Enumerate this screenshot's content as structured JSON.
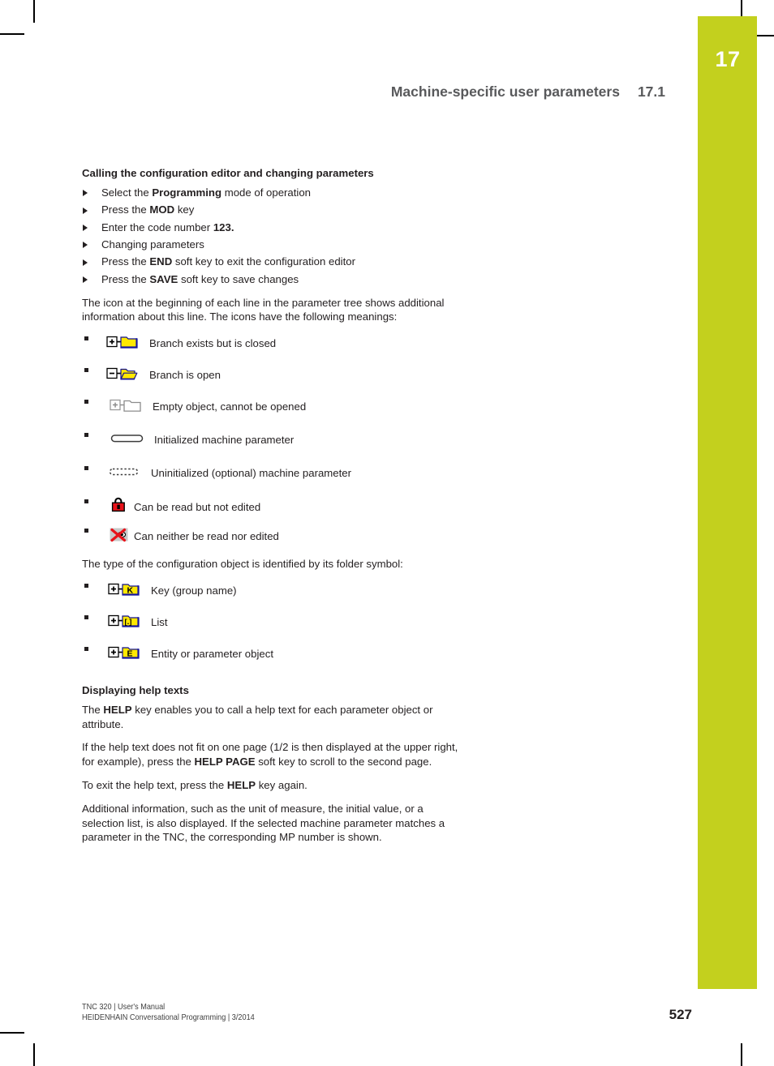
{
  "page": {
    "number": "527",
    "chapter_tab_number": "17",
    "accent_color": "#c3d01e",
    "running_head": {
      "title": "Machine-specific user parameters",
      "section": "17.1"
    }
  },
  "content": {
    "heading_1": "Calling the configuration editor and changing parameters",
    "steps": [
      {
        "prefix": "Select the ",
        "strong": "Programming",
        "suffix": " mode of operation"
      },
      {
        "prefix": "Press the ",
        "strong": "MOD",
        "suffix": " key"
      },
      {
        "prefix": "Enter the code number ",
        "strong": "123.",
        "suffix": ""
      },
      {
        "prefix": "Changing parameters",
        "strong": "",
        "suffix": ""
      },
      {
        "prefix": "Press the ",
        "strong": "END",
        "suffix": " soft key to exit the configuration editor"
      },
      {
        "prefix": "Press the ",
        "strong": "SAVE",
        "suffix": " soft key to save changes"
      }
    ],
    "paragraph_icons_intro": "The icon at the beginning of each line in the parameter tree shows additional information about this line. The icons have the following meanings:",
    "icon_items": [
      {
        "icon": "folder-closed-plus-icon",
        "label": "Branch exists but is closed"
      },
      {
        "icon": "folder-open-minus-icon",
        "label": "Branch is open"
      },
      {
        "icon": "folder-empty-plus-icon",
        "label": "Empty object, cannot be opened"
      },
      {
        "icon": "parameter-initialized-icon",
        "label": "Initialized machine parameter"
      },
      {
        "icon": "parameter-uninitialized-icon",
        "label": "Uninitialized (optional) machine parameter"
      },
      {
        "icon": "padlock-red-icon",
        "label": "Can be read but not edited"
      },
      {
        "icon": "no-access-red-x-icon",
        "label": "Can neither be read nor edited"
      }
    ],
    "paragraph_folder_intro": "The type of the configuration object is identified by its folder symbol:",
    "folder_items": [
      {
        "icon": "folder-key-icon",
        "glyph": "K",
        "label": "Key (group name)"
      },
      {
        "icon": "folder-list-icon",
        "glyph": "[.]",
        "label": "List"
      },
      {
        "icon": "folder-entity-icon",
        "glyph": "E",
        "label": "Entity or parameter object"
      }
    ],
    "heading_2": "Displaying help texts",
    "help_paragraph_1": {
      "prefix": "The ",
      "strong": "HELP",
      "suffix": " key enables you to call a help text for each parameter object or attribute."
    },
    "help_paragraph_2": {
      "prefix": "If the help text does not fit on one page (1/2 is then displayed at the upper right, for example), press the ",
      "strong": "HELP PAGE",
      "suffix": " soft key to scroll to the second page."
    },
    "help_paragraph_3": {
      "prefix": "To exit the help text, press the ",
      "strong": "HELP",
      "suffix": " key again."
    },
    "help_paragraph_4": "Additional information, such as the unit of measure, the initial value, or a selection list, is also displayed. If the selected machine parameter matches a parameter in the TNC, the corresponding MP number is shown."
  },
  "footer": {
    "line_1": "TNC 320 | User's Manual",
    "line_2": "HEIDENHAIN Conversational Programming | 3/2014"
  }
}
